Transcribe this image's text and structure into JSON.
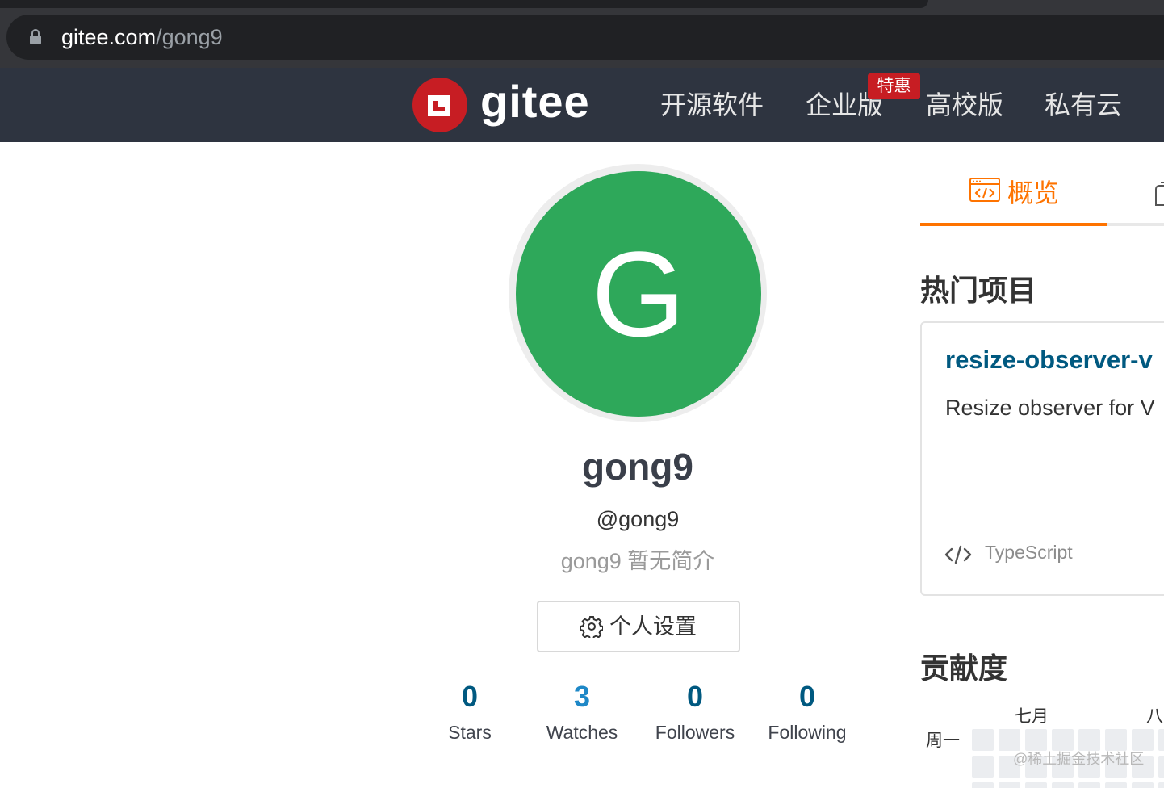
{
  "browser": {
    "url_host": "gitee.com",
    "url_path": "/gong9"
  },
  "header": {
    "logo_text": "gitee",
    "nav": [
      "开源软件",
      "企业版",
      "高校版",
      "私有云"
    ],
    "promo_badge": "特惠"
  },
  "profile": {
    "avatar_letter": "G",
    "avatar_color": "#2ea85a",
    "display_name": "gong9",
    "username": "@gong9",
    "bio": "gong9 暂无简介",
    "settings_label": "个人设置",
    "stats": [
      {
        "count": "0",
        "label": "Stars"
      },
      {
        "count": "3",
        "label": "Watches"
      },
      {
        "count": "0",
        "label": "Followers"
      },
      {
        "count": "0",
        "label": "Following"
      }
    ]
  },
  "tabs": {
    "overview_label": "概览"
  },
  "popular": {
    "title": "热门项目",
    "project_name": "resize-observer-v",
    "project_desc": "Resize observer for V",
    "project_lang": "TypeScript"
  },
  "contribution": {
    "title": "贡献度",
    "months": [
      "七月",
      "八"
    ],
    "weekday": "周一"
  },
  "watermark": "@稀土掘金技术社区",
  "colors": {
    "accent_orange": "#fe7300",
    "link_blue": "#005980",
    "brand_red": "#c71d23"
  }
}
